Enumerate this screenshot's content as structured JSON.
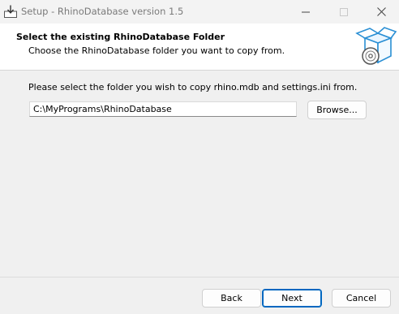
{
  "window": {
    "title": "Setup - RhinoDatabase version 1.5"
  },
  "header": {
    "title": "Select the existing RhinoDatabase Folder",
    "subtitle": "Choose the RhinoDatabase folder you want to copy from."
  },
  "body": {
    "instruction": "Please select the folder you wish to copy rhino.mdb and settings.ini from.",
    "folder_path": "C:\\MyPrograms\\RhinoDatabase",
    "browse_label": "Browse..."
  },
  "footer": {
    "back_label": "Back",
    "next_label": "Next",
    "cancel_label": "Cancel"
  },
  "icons": {
    "app": "setup-download-icon",
    "minimize": "minimize-icon",
    "maximize": "maximize-icon",
    "close": "close-icon",
    "header": "box-with-disc-icon"
  },
  "colors": {
    "accent": "#0067c0",
    "header_bg": "#ffffff",
    "window_bg": "#f0f0f0"
  }
}
